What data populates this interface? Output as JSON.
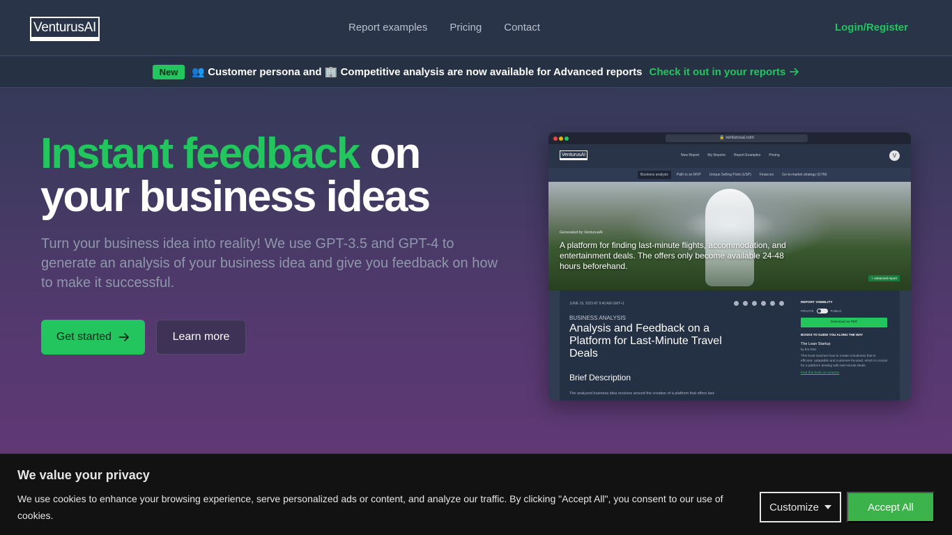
{
  "nav": {
    "logo": "VenturusAI",
    "links": [
      "Report examples",
      "Pricing",
      "Contact"
    ],
    "login": "Login/Register"
  },
  "announcement": {
    "badge": "New",
    "text": "👥 Customer persona and 🏢 Competitive analysis are now available for Advanced reports",
    "link": "Check it out in your reports"
  },
  "hero": {
    "title_accent": "Instant feedback",
    "title_rest_1": " on",
    "title_rest_2": "your business ideas",
    "subtitle": "Turn your business idea into reality! We use GPT-3.5 and GPT-4 to generate an analysis of your business idea and give you feedback on how to make it successful.",
    "primary_button": "Get started",
    "secondary_button": "Learn more"
  },
  "preview": {
    "url": "🔒 venturusai.com",
    "logo": "VenturusAI",
    "nav_links": [
      "New Report",
      "My Reports",
      "Report Examples",
      "Pricing"
    ],
    "avatar": "V",
    "tabs": [
      "Business analysis",
      "Path to an MVP",
      "Unique Selling Point (USP)",
      "Finances",
      "Go-to-market strategy (GTM)"
    ],
    "generated_by": "Generated by VenturusAI",
    "hero_title": "A platform for finding last-minute flights, accommodation, and entertainment deals. The offers only become available 24-48 hours beforehand.",
    "advanced_badge": "+ Advanced report",
    "date": "JUNE 19, 2023 AT 9:40 AM GMT+1",
    "section": "BUSINESS ANALYSIS",
    "card_title": "Analysis and Feedback on a Platform for Last-Minute Travel Deals",
    "brief_heading": "Brief Description",
    "brief_text": "The analyzed business idea revolves around the creation of a platform that offers last-",
    "visibility_heading": "REPORT VISIBILITY",
    "private_label": "PRIVATE",
    "public_label": "PUBLIC",
    "download": "Download as PDF",
    "books_heading": "BOOKS TO GUIDE YOU ALONG THE WAY",
    "book_title": "The Lean Startup",
    "book_author": "by Eric Ries",
    "book_desc": "This book teaches how to create a business that is efficient, adaptable and customer-focused, which is crucial for a platform dealing with last-minute deals.",
    "book_link": "Find this book on Amazon"
  },
  "cookie": {
    "title": "We value your privacy",
    "text": "We use cookies to enhance your browsing experience, serve personalized ads or content, and analyze our traffic. By clicking \"Accept All\", you consent to our use of cookies.",
    "customize": "Customize",
    "accept": "Accept All"
  },
  "colors": {
    "accent": "#22c55e",
    "nav_bg": "#2a3449",
    "cookie_bg": "#121212",
    "accept_bg": "#3cb34a"
  }
}
